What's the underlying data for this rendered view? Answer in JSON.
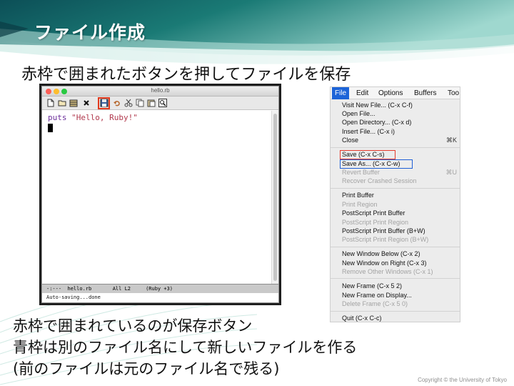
{
  "slide": {
    "title": "ファイル作成",
    "subtitle": "赤枠で囲まれたボタンを押してファイルを保存",
    "notes": [
      "赤枠で囲まれているのが保存ボタン",
      "青枠は別のファイル名にして新しいファイルを作る",
      "(前のファイルは元のファイル名で残る)"
    ],
    "copyright": "Copyright © the University of Tokyo"
  },
  "colors": {
    "header_teal": "#1a6e6a",
    "header_light": "#8fd0c8",
    "highlight_red": "#e23a1e",
    "highlight_blue": "#1f5fd6",
    "menu_active": "#1d64d8"
  },
  "emacs": {
    "window_title": "hello.rb",
    "toolbar_icons": [
      "new-file-icon",
      "open-folder-icon",
      "open-directory-icon",
      "close-x-icon",
      "save-icon",
      "undo-icon",
      "cut-icon",
      "copy-icon",
      "paste-icon",
      "search-icon"
    ],
    "code": {
      "keyword": "puts",
      "string": "\"Hello, Ruby!\""
    },
    "modeline": "-:---  hello.rb       All L2     (Ruby +3)",
    "minibuffer": "Auto-saving...done"
  },
  "menu": {
    "menubar": [
      "File",
      "Edit",
      "Options",
      "Buffers",
      "Too"
    ],
    "active": "File",
    "groups": [
      [
        {
          "label": "Visit New File... (C-x C-f)",
          "shortcut": "",
          "enabled": true
        },
        {
          "label": "Open File...",
          "shortcut": "",
          "enabled": true
        },
        {
          "label": "Open Directory... (C-x d)",
          "shortcut": "",
          "enabled": true
        },
        {
          "label": "Insert File... (C-x i)",
          "shortcut": "",
          "enabled": true
        },
        {
          "label": "Close",
          "shortcut": "⌘K",
          "enabled": true
        }
      ],
      [
        {
          "label": "Save (C-x C-s)",
          "shortcut": "",
          "enabled": true
        },
        {
          "label": "Save As... (C-x C-w)",
          "shortcut": "",
          "enabled": true
        },
        {
          "label": "Revert Buffer",
          "shortcut": "⌘U",
          "enabled": false
        },
        {
          "label": "Recover Crashed Session",
          "shortcut": "",
          "enabled": false
        }
      ],
      [
        {
          "label": "Print Buffer",
          "shortcut": "",
          "enabled": true
        },
        {
          "label": "Print Region",
          "shortcut": "",
          "enabled": false
        },
        {
          "label": "PostScript Print Buffer",
          "shortcut": "",
          "enabled": true
        },
        {
          "label": "PostScript Print Region",
          "shortcut": "",
          "enabled": false
        },
        {
          "label": "PostScript Print Buffer (B+W)",
          "shortcut": "",
          "enabled": true
        },
        {
          "label": "PostScript Print Region (B+W)",
          "shortcut": "",
          "enabled": false
        }
      ],
      [
        {
          "label": "New Window Below (C-x 2)",
          "shortcut": "",
          "enabled": true
        },
        {
          "label": "New Window on Right (C-x 3)",
          "shortcut": "",
          "enabled": true
        },
        {
          "label": "Remove Other Windows (C-x 1)",
          "shortcut": "",
          "enabled": false
        }
      ],
      [
        {
          "label": "New Frame (C-x 5 2)",
          "shortcut": "",
          "enabled": true
        },
        {
          "label": "New Frame on Display...",
          "shortcut": "",
          "enabled": true
        },
        {
          "label": "Delete Frame (C-x 5 0)",
          "shortcut": "",
          "enabled": false
        }
      ],
      [
        {
          "label": "Quit (C-x C-c)",
          "shortcut": "",
          "enabled": true
        }
      ]
    ]
  }
}
